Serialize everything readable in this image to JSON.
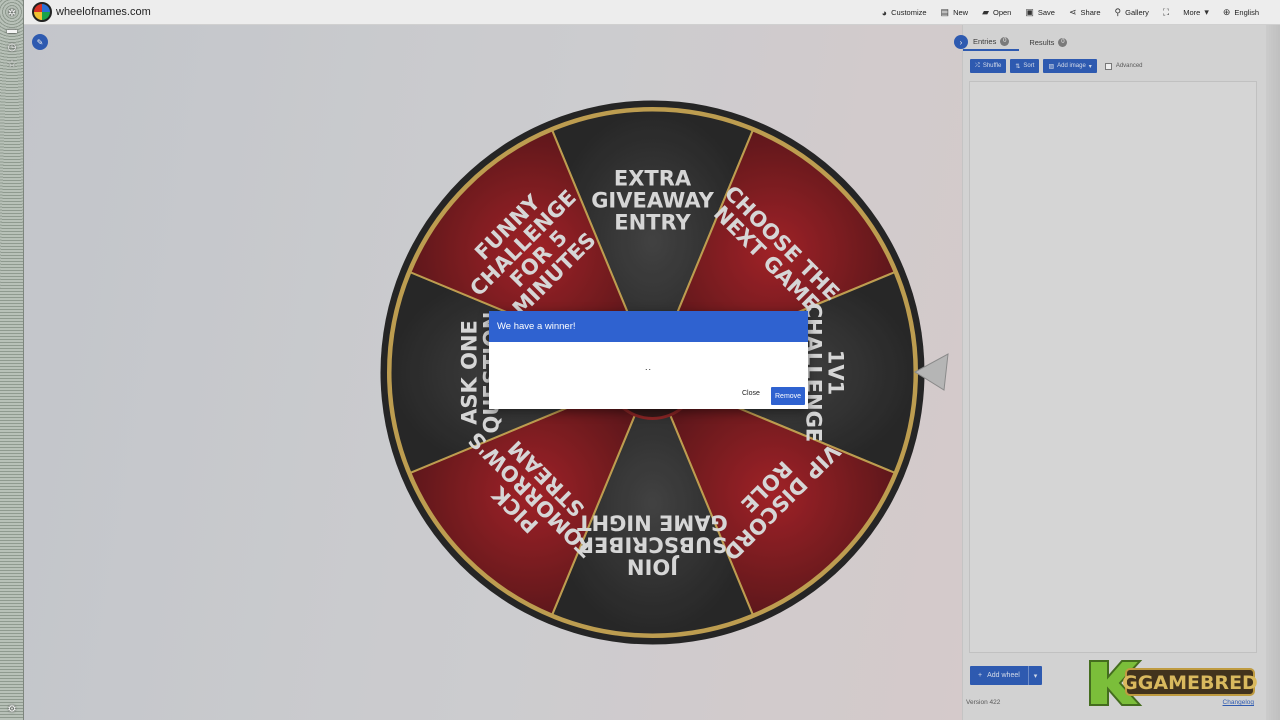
{
  "topbar": {
    "site_name": "wheelofnames.com",
    "menu": [
      {
        "label": "Customize",
        "icon": "palette-icon",
        "glyph": "◕"
      },
      {
        "label": "New",
        "icon": "new-file-icon",
        "glyph": "▤"
      },
      {
        "label": "Open",
        "icon": "folder-icon",
        "glyph": "▰"
      },
      {
        "label": "Save",
        "icon": "save-icon",
        "glyph": "▣"
      },
      {
        "label": "Share",
        "icon": "share-icon",
        "glyph": "⋖"
      },
      {
        "label": "Gallery",
        "icon": "search-icon",
        "glyph": "⚲"
      },
      {
        "label": "",
        "icon": "fullscreen-icon",
        "glyph": "⛶"
      },
      {
        "label": "More",
        "icon": "chevron-down-icon",
        "glyph": "▾"
      },
      {
        "label": "English",
        "icon": "globe-icon",
        "glyph": "⊕"
      }
    ]
  },
  "wheel": {
    "slices": [
      "EXTRA GIVEAWAY ENTRY",
      "CHOOSE THE NEXT GAME",
      "1V1 CHALLENGE",
      "VIP DISCORD ROLE",
      "JOIN SUBSCRIBER GAME NIGHT",
      "PICK TOMORROW'S STREAM",
      "ASK ONE QUESTION",
      "FUNNY CHALLENGE FOR 5 MINUTES"
    ],
    "colors": {
      "dark": "#262626",
      "red": "#7a0f14",
      "rim": "#c7a24a"
    }
  },
  "panel": {
    "tabs": [
      {
        "label": "Entries",
        "count": "0"
      },
      {
        "label": "Results",
        "count": "0"
      }
    ],
    "toolbar": {
      "shuffle": "Shuffle",
      "sort": "Sort",
      "add_image": "Add image",
      "advanced": "Advanced"
    },
    "add_wheel": "Add wheel",
    "version": "Version 422",
    "changelog": "Changelog"
  },
  "dialog": {
    "title": "We have a winner!",
    "winner": "..",
    "close": "Close",
    "remove": "Remove"
  },
  "brand": {
    "text": "GGAMEBRED",
    "letter": "K"
  }
}
